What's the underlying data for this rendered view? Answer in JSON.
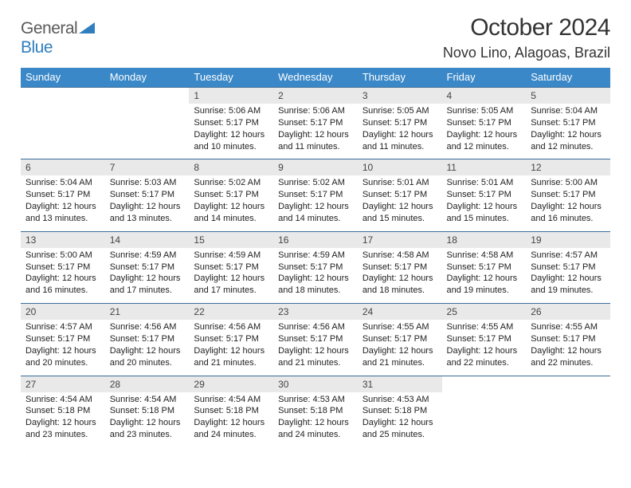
{
  "logo": {
    "part1": "General",
    "part2": "Blue"
  },
  "title": "October 2024",
  "location": "Novo Lino, Alagoas, Brazil",
  "weekdays": [
    "Sunday",
    "Monday",
    "Tuesday",
    "Wednesday",
    "Thursday",
    "Friday",
    "Saturday"
  ],
  "weeks": [
    [
      null,
      null,
      {
        "n": "1",
        "sr": "Sunrise: 5:06 AM",
        "ss": "Sunset: 5:17 PM",
        "dl": "Daylight: 12 hours and 10 minutes."
      },
      {
        "n": "2",
        "sr": "Sunrise: 5:06 AM",
        "ss": "Sunset: 5:17 PM",
        "dl": "Daylight: 12 hours and 11 minutes."
      },
      {
        "n": "3",
        "sr": "Sunrise: 5:05 AM",
        "ss": "Sunset: 5:17 PM",
        "dl": "Daylight: 12 hours and 11 minutes."
      },
      {
        "n": "4",
        "sr": "Sunrise: 5:05 AM",
        "ss": "Sunset: 5:17 PM",
        "dl": "Daylight: 12 hours and 12 minutes."
      },
      {
        "n": "5",
        "sr": "Sunrise: 5:04 AM",
        "ss": "Sunset: 5:17 PM",
        "dl": "Daylight: 12 hours and 12 minutes."
      }
    ],
    [
      {
        "n": "6",
        "sr": "Sunrise: 5:04 AM",
        "ss": "Sunset: 5:17 PM",
        "dl": "Daylight: 12 hours and 13 minutes."
      },
      {
        "n": "7",
        "sr": "Sunrise: 5:03 AM",
        "ss": "Sunset: 5:17 PM",
        "dl": "Daylight: 12 hours and 13 minutes."
      },
      {
        "n": "8",
        "sr": "Sunrise: 5:02 AM",
        "ss": "Sunset: 5:17 PM",
        "dl": "Daylight: 12 hours and 14 minutes."
      },
      {
        "n": "9",
        "sr": "Sunrise: 5:02 AM",
        "ss": "Sunset: 5:17 PM",
        "dl": "Daylight: 12 hours and 14 minutes."
      },
      {
        "n": "10",
        "sr": "Sunrise: 5:01 AM",
        "ss": "Sunset: 5:17 PM",
        "dl": "Daylight: 12 hours and 15 minutes."
      },
      {
        "n": "11",
        "sr": "Sunrise: 5:01 AM",
        "ss": "Sunset: 5:17 PM",
        "dl": "Daylight: 12 hours and 15 minutes."
      },
      {
        "n": "12",
        "sr": "Sunrise: 5:00 AM",
        "ss": "Sunset: 5:17 PM",
        "dl": "Daylight: 12 hours and 16 minutes."
      }
    ],
    [
      {
        "n": "13",
        "sr": "Sunrise: 5:00 AM",
        "ss": "Sunset: 5:17 PM",
        "dl": "Daylight: 12 hours and 16 minutes."
      },
      {
        "n": "14",
        "sr": "Sunrise: 4:59 AM",
        "ss": "Sunset: 5:17 PM",
        "dl": "Daylight: 12 hours and 17 minutes."
      },
      {
        "n": "15",
        "sr": "Sunrise: 4:59 AM",
        "ss": "Sunset: 5:17 PM",
        "dl": "Daylight: 12 hours and 17 minutes."
      },
      {
        "n": "16",
        "sr": "Sunrise: 4:59 AM",
        "ss": "Sunset: 5:17 PM",
        "dl": "Daylight: 12 hours and 18 minutes."
      },
      {
        "n": "17",
        "sr": "Sunrise: 4:58 AM",
        "ss": "Sunset: 5:17 PM",
        "dl": "Daylight: 12 hours and 18 minutes."
      },
      {
        "n": "18",
        "sr": "Sunrise: 4:58 AM",
        "ss": "Sunset: 5:17 PM",
        "dl": "Daylight: 12 hours and 19 minutes."
      },
      {
        "n": "19",
        "sr": "Sunrise: 4:57 AM",
        "ss": "Sunset: 5:17 PM",
        "dl": "Daylight: 12 hours and 19 minutes."
      }
    ],
    [
      {
        "n": "20",
        "sr": "Sunrise: 4:57 AM",
        "ss": "Sunset: 5:17 PM",
        "dl": "Daylight: 12 hours and 20 minutes."
      },
      {
        "n": "21",
        "sr": "Sunrise: 4:56 AM",
        "ss": "Sunset: 5:17 PM",
        "dl": "Daylight: 12 hours and 20 minutes."
      },
      {
        "n": "22",
        "sr": "Sunrise: 4:56 AM",
        "ss": "Sunset: 5:17 PM",
        "dl": "Daylight: 12 hours and 21 minutes."
      },
      {
        "n": "23",
        "sr": "Sunrise: 4:56 AM",
        "ss": "Sunset: 5:17 PM",
        "dl": "Daylight: 12 hours and 21 minutes."
      },
      {
        "n": "24",
        "sr": "Sunrise: 4:55 AM",
        "ss": "Sunset: 5:17 PM",
        "dl": "Daylight: 12 hours and 21 minutes."
      },
      {
        "n": "25",
        "sr": "Sunrise: 4:55 AM",
        "ss": "Sunset: 5:17 PM",
        "dl": "Daylight: 12 hours and 22 minutes."
      },
      {
        "n": "26",
        "sr": "Sunrise: 4:55 AM",
        "ss": "Sunset: 5:17 PM",
        "dl": "Daylight: 12 hours and 22 minutes."
      }
    ],
    [
      {
        "n": "27",
        "sr": "Sunrise: 4:54 AM",
        "ss": "Sunset: 5:18 PM",
        "dl": "Daylight: 12 hours and 23 minutes."
      },
      {
        "n": "28",
        "sr": "Sunrise: 4:54 AM",
        "ss": "Sunset: 5:18 PM",
        "dl": "Daylight: 12 hours and 23 minutes."
      },
      {
        "n": "29",
        "sr": "Sunrise: 4:54 AM",
        "ss": "Sunset: 5:18 PM",
        "dl": "Daylight: 12 hours and 24 minutes."
      },
      {
        "n": "30",
        "sr": "Sunrise: 4:53 AM",
        "ss": "Sunset: 5:18 PM",
        "dl": "Daylight: 12 hours and 24 minutes."
      },
      {
        "n": "31",
        "sr": "Sunrise: 4:53 AM",
        "ss": "Sunset: 5:18 PM",
        "dl": "Daylight: 12 hours and 25 minutes."
      },
      null,
      null
    ]
  ]
}
